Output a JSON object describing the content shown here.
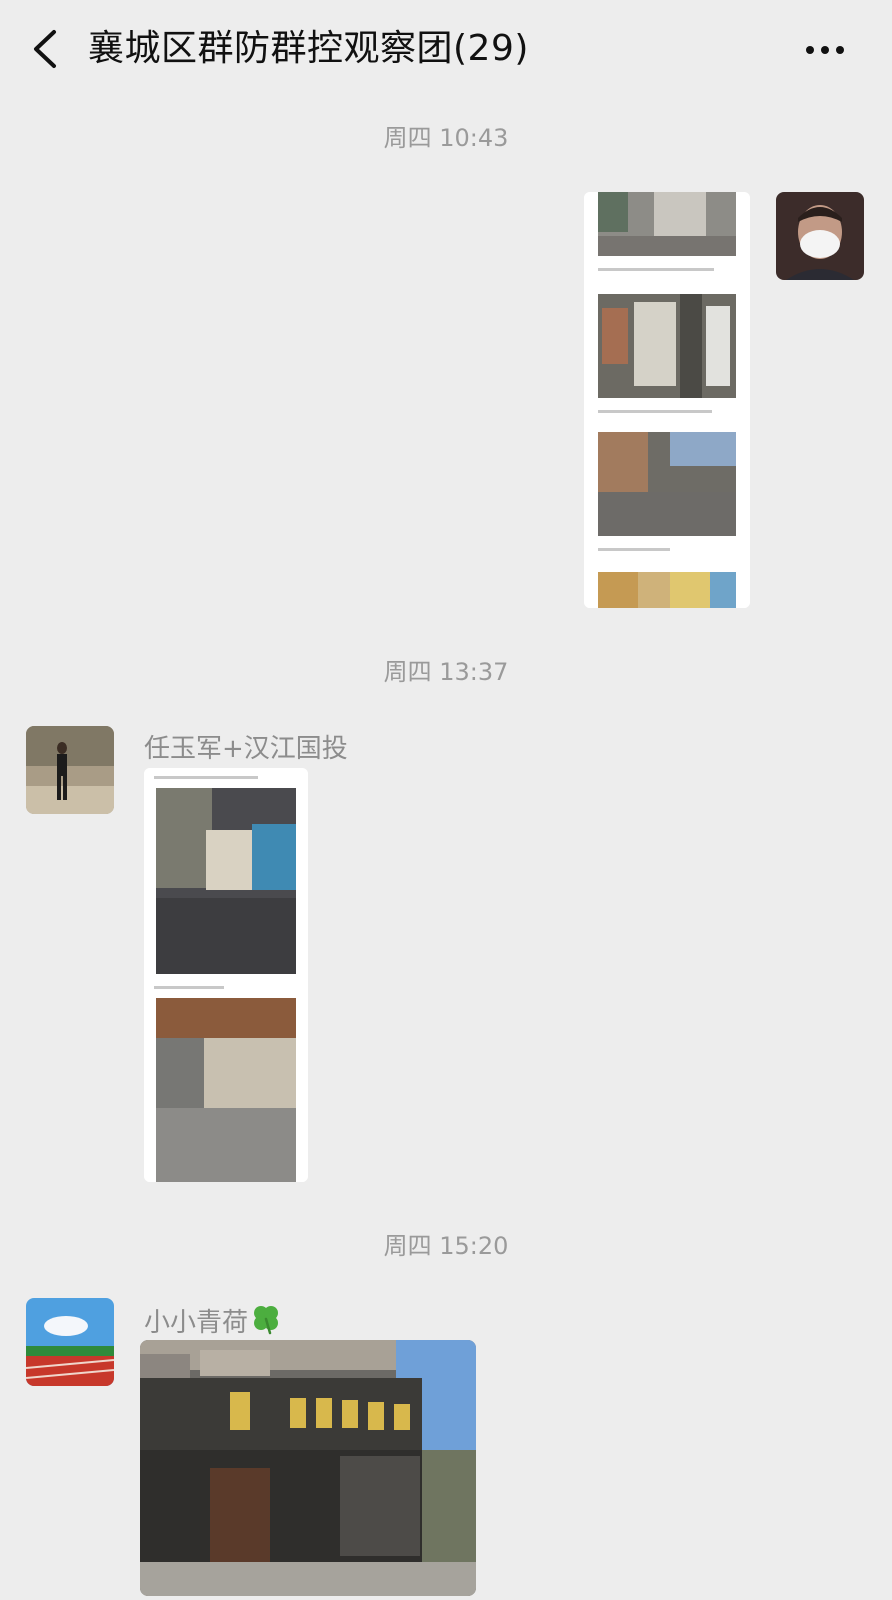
{
  "header": {
    "title": "襄城区群防群控观察团(29)"
  },
  "messages": [
    {
      "time": "周四 10:43",
      "type": "image-doc",
      "outgoing": true
    },
    {
      "time": "周四 13:37",
      "sender": "任玉军+汉江国投",
      "type": "image-doc",
      "outgoing": false
    },
    {
      "time": "周四 15:20",
      "sender": "小小青荷",
      "sender_emoji": "four-leaf-clover",
      "type": "image",
      "outgoing": false
    }
  ],
  "colors": {
    "background": "#ededed",
    "title": "#111111",
    "timestamp": "#9a9a9a",
    "sender": "#8c8c8c"
  }
}
